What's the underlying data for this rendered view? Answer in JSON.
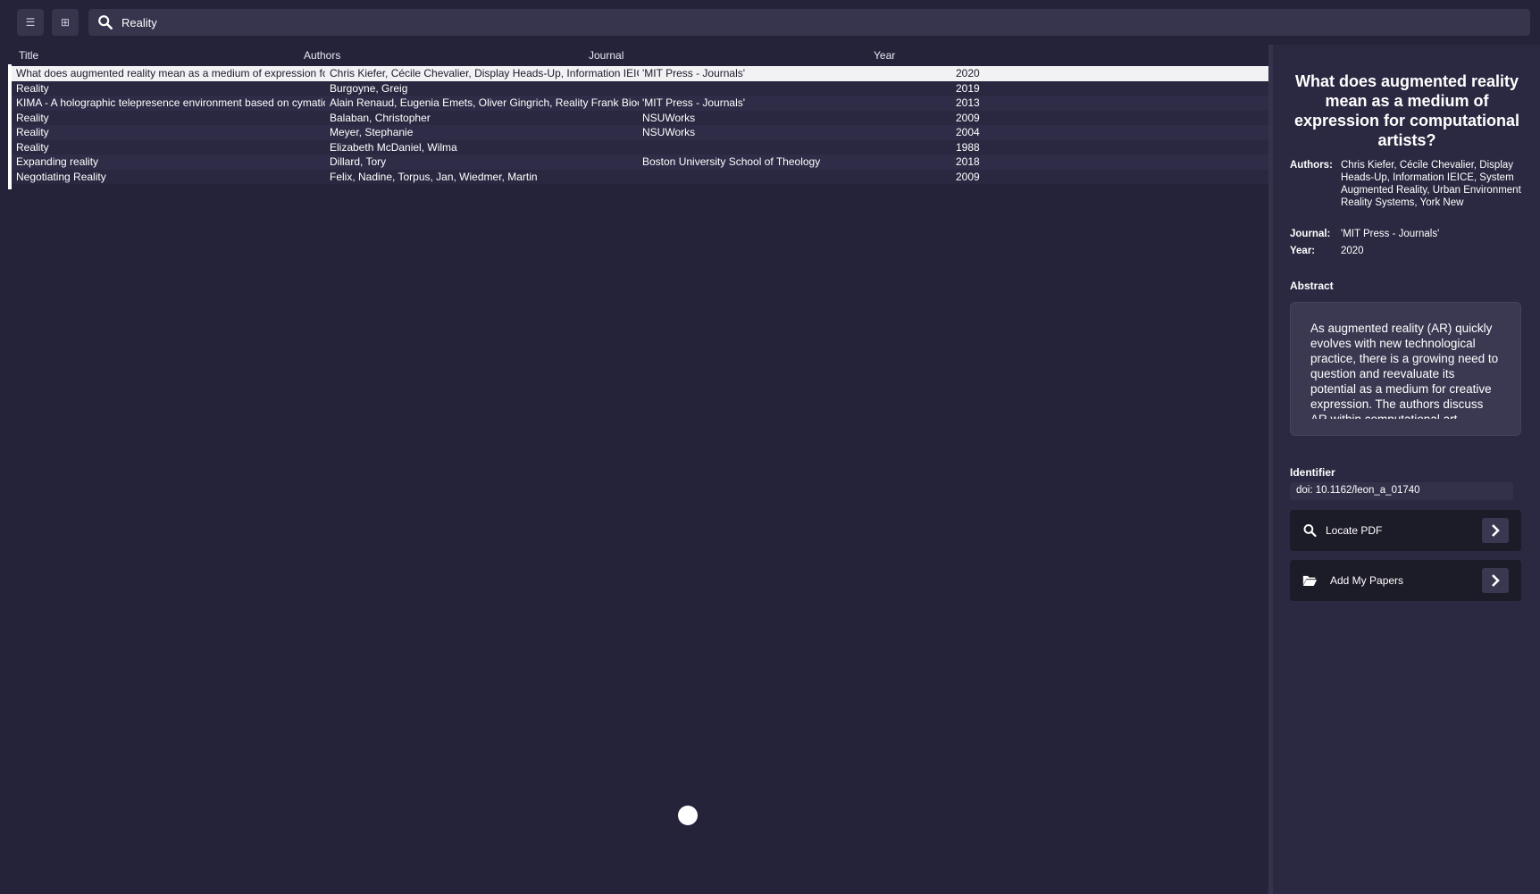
{
  "toolbar": {
    "menu_icon": "☰",
    "grid_icon": "⊞",
    "search_value": "Reality"
  },
  "table": {
    "columns": [
      "Title",
      "Authors",
      "Journal",
      "Year"
    ],
    "rows": [
      {
        "title": "What does augmented reality mean as a medium of expression for computational artists?",
        "authors": "Chris Kiefer, Cécile Chevalier, Display Heads-Up, Information IEICE, System Augmented Reality, Urban Environment Reality Systems, York New",
        "journal": "'MIT Press - Journals'",
        "year": "2020"
      },
      {
        "title": "Reality",
        "authors": "Burgoyne, Greig",
        "journal": "",
        "year": "2019"
      },
      {
        "title": "KIMA - A holographic telepresence environment based on cymatic principles",
        "authors": "Alain Renaud, Eugenia Emets, Oliver Gingrich, Reality Frank Biocca",
        "journal": "'MIT Press - Journals'",
        "year": "2013"
      },
      {
        "title": "Reality",
        "authors": "Balaban, Christopher",
        "journal": "NSUWorks",
        "year": "2009"
      },
      {
        "title": "Reality",
        "authors": "Meyer, Stephanie",
        "journal": "NSUWorks",
        "year": "2004"
      },
      {
        "title": "Reality",
        "authors": "Elizabeth McDaniel, Wilma",
        "journal": "",
        "year": "1988"
      },
      {
        "title": "Expanding reality",
        "authors": "Dillard, Tory",
        "journal": "Boston University School of Theology",
        "year": "2018"
      },
      {
        "title": "Negotiating Reality",
        "authors": "Felix, Nadine, Torpus, Jan, Wiedmer, Martin",
        "journal": "",
        "year": "2009"
      }
    ]
  },
  "detail": {
    "title": "What does augmented reality mean as a medium of expression for computational artists?",
    "authors_label": "Authors:",
    "authors": "Chris Kiefer, Cécile Chevalier, Display Heads-Up, Information IEICE, System Augmented Reality, Urban Environment Reality Systems, York New",
    "journal_label": "Journal:",
    "journal": "'MIT Press - Journals'",
    "year_label": "Year:",
    "year": "2020",
    "abstract_label": "Abstract",
    "abstract": "As augmented reality (AR) quickly evolves with new technological practice, there is a growing need to question and reevaluate its potential as a medium for creative expression. The authors discuss AR within computational art",
    "identifier_label": "Identifier",
    "identifier": "doi: 10.1162/leon_a_01740",
    "locate_pdf_label": "Locate PDF",
    "add_papers_label": "Add My Papers"
  }
}
